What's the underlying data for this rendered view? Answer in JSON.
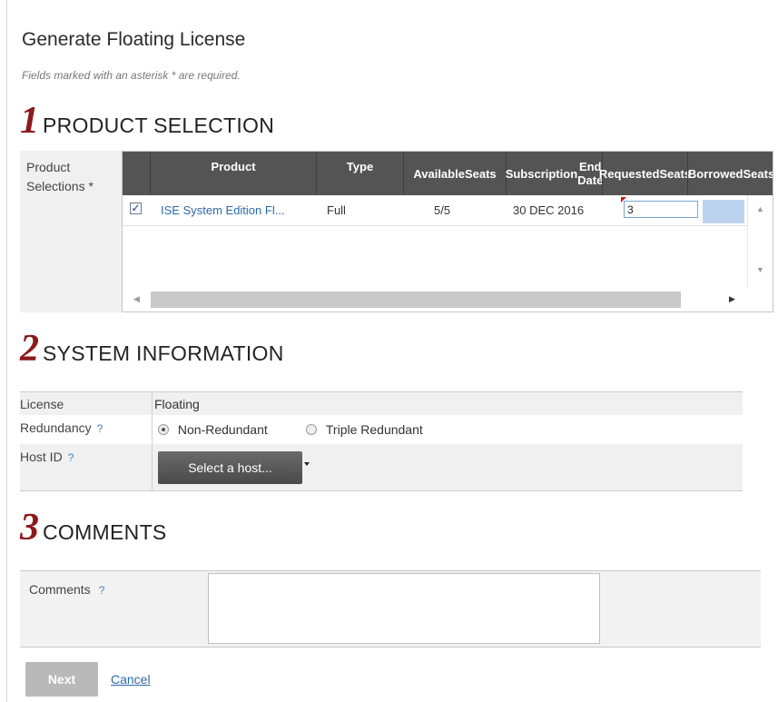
{
  "page": {
    "title": "Generate Floating License",
    "required_note": "Fields marked with an asterisk * are required."
  },
  "sections": {
    "product_selection": {
      "number": "1",
      "title": "PRODUCT SELECTION"
    },
    "system_information": {
      "number": "2",
      "title": "SYSTEM INFORMATION"
    },
    "comments": {
      "number": "3",
      "title": "COMMENTS"
    }
  },
  "product_selection": {
    "label_line1": "Product",
    "label_line2": "Selections *",
    "columns": {
      "product": "Product",
      "type": "Type",
      "available_1": "Available",
      "available_2": "Seats",
      "subscription_1": "Subscription",
      "subscription_2": "End Date",
      "requested_1": "Requested",
      "requested_2": "Seats",
      "borrowed_1": "Borrowed",
      "borrowed_2": "Seats"
    },
    "rows": [
      {
        "checked": "✓",
        "product": "ISE System Edition Fl...",
        "type": "Full",
        "available": "5/5",
        "subscription_end": "30 DEC 2016",
        "requested": "3"
      }
    ],
    "scroll_icons": {
      "up": "▲",
      "down": "▼",
      "left": "◀",
      "right": "▶"
    }
  },
  "system_information": {
    "license_label": "License",
    "license_value": "Floating",
    "redundancy_label": "Redundancy",
    "redundancy_options": [
      "Non-Redundant",
      "Triple Redundant"
    ],
    "redundancy_selected": "Non-Redundant",
    "host_label": "Host ID",
    "host_button": "Select a host...",
    "help": "?"
  },
  "comments": {
    "label": "Comments",
    "help": "?",
    "value": ""
  },
  "actions": {
    "next": "Next",
    "cancel": "Cancel"
  },
  "colors": {
    "section_number": "#8b1a1a",
    "header_bg": "#545454",
    "link": "#2c6aa8"
  }
}
